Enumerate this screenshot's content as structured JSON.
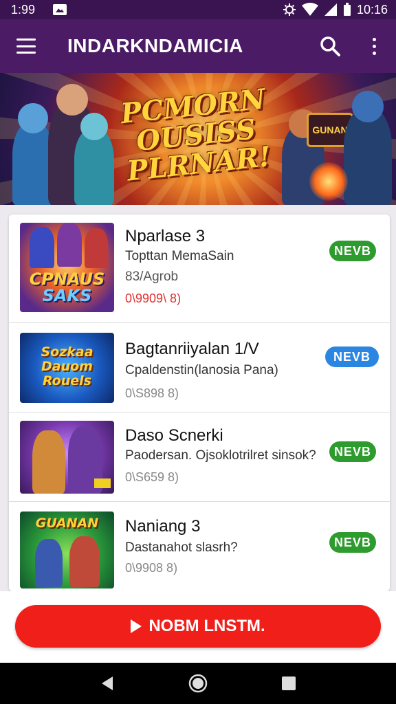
{
  "status_bar": {
    "time_left": "1:99",
    "time_right": "10:16"
  },
  "app_bar": {
    "title": "INDARKNDAMICIA"
  },
  "banner": {
    "title_lines": [
      "PCMORN",
      "OUSISS",
      "PLRNAR!"
    ],
    "badge_text": "GUNAN"
  },
  "items": [
    {
      "name": "Nparlase 3",
      "subtitle": "Topttan MemaSain",
      "detail": "83/Agrob",
      "meta": "0\\9909\\ 8)",
      "badge": "NEVB",
      "badge_color": "#2e9b2e",
      "thumb_text": "CPNAUS\nSAKS"
    },
    {
      "name": "Bagtanriiyalan 1/V",
      "subtitle": "Cpaldenstin(lanosia Pana)",
      "meta": "0\\S898 8)",
      "badge": "NEVB",
      "badge_color": "#2a86e0",
      "thumb_text": "Sozkaa\nDauom\nRouels"
    },
    {
      "name": "Daso Scnerki",
      "subtitle": "Paodersan. Ojsoklotrilret sinsok?",
      "meta": "0\\S659 8)",
      "badge": "NEVB",
      "badge_color": "#2e9b2e",
      "thumb_text": ""
    },
    {
      "name": "Naniang 3",
      "subtitle": "Dastanahot slasrh?",
      "meta": "0\\9908 8)",
      "badge": "NEVB",
      "badge_color": "#2e9b2e",
      "thumb_text": "GUANAN"
    }
  ],
  "cta": {
    "label": "NOBM LNSTM."
  },
  "colors": {
    "appbar": "#4b1b66",
    "cta": "#f01f1a",
    "badge_green": "#2e9b2e",
    "badge_blue": "#2a86e0"
  },
  "icons": {
    "menu": "menu-icon",
    "search": "search-icon",
    "more": "more-vert-icon",
    "back": "back-icon",
    "home": "home-icon",
    "recents": "recents-icon"
  }
}
